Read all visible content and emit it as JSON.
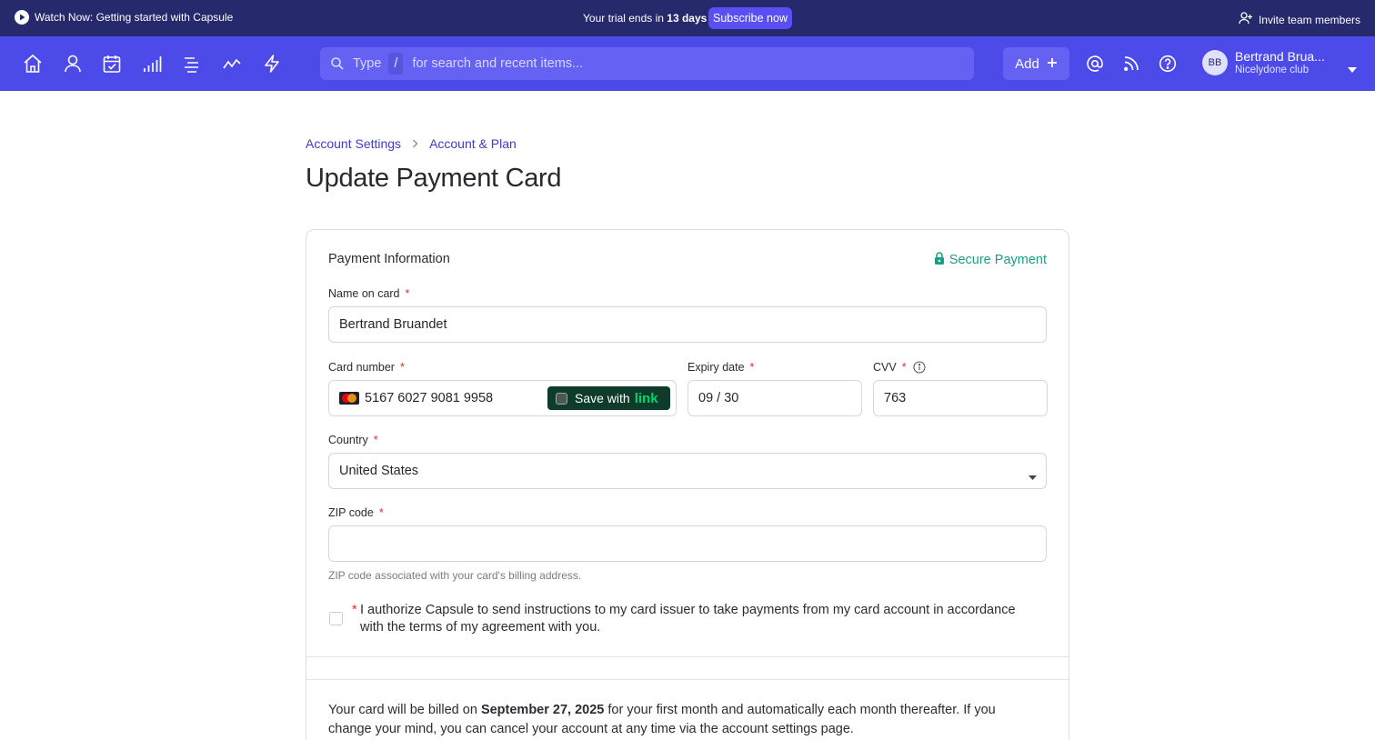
{
  "banner": {
    "watch_label": "Watch Now: Getting started with Capsule",
    "trial_prefix": "Your trial ends in",
    "trial_days": "13 days",
    "subscribe_label": "Subscribe now",
    "invite_label": "Invite team members"
  },
  "nav": {
    "icons": [
      "home-icon",
      "person-icon",
      "calendar-check-icon",
      "bar-chart-icon",
      "list-icon",
      "trend-line-icon",
      "lightning-icon"
    ],
    "search_hint_before": "Type",
    "search_key": "/",
    "search_hint_after": "for search and recent items...",
    "add_label": "Add",
    "right_icons": [
      "at-icon",
      "rss-icon",
      "help-icon"
    ],
    "user": {
      "initials": "BB",
      "name": "Bertrand Brua...",
      "org": "Nicelydone club"
    }
  },
  "breadcrumb": {
    "items": [
      "Account Settings",
      "Account & Plan"
    ]
  },
  "page_title": "Update Payment Card",
  "form": {
    "section_title": "Payment Information",
    "secure_label": "Secure Payment",
    "name_label": "Name on card",
    "name_value": "Bertrand Bruandet",
    "card_label": "Card number",
    "card_value": "5167 6027 9081 9958",
    "save_with": "Save with",
    "link_brand": "link",
    "expiry_label": "Expiry date",
    "expiry_value": "09 / 30",
    "cvv_label": "CVV",
    "cvv_value": "763",
    "country_label": "Country",
    "country_value": "United States",
    "zip_label": "ZIP code",
    "zip_value": "",
    "zip_hint": "ZIP code associated with your card's billing address.",
    "required_mark": "*",
    "authorize_text": "I authorize Capsule to send instructions to my card issuer to take payments from my card account in accordance with the terms of my agreement with you."
  },
  "billing": {
    "prefix": "Your card will be billed on",
    "date": "September 27, 2025",
    "suffix": "for your first month and automatically each month thereafter. If you change your mind, you can cancel your account at any time via the account settings page."
  },
  "colors": {
    "banner_bg": "#26296b",
    "nav_bg": "#4c4ae9",
    "accent": "#5a4ff3",
    "link": "#3f3cc9",
    "secure": "#1a9e86",
    "required": "#e02b2b"
  }
}
